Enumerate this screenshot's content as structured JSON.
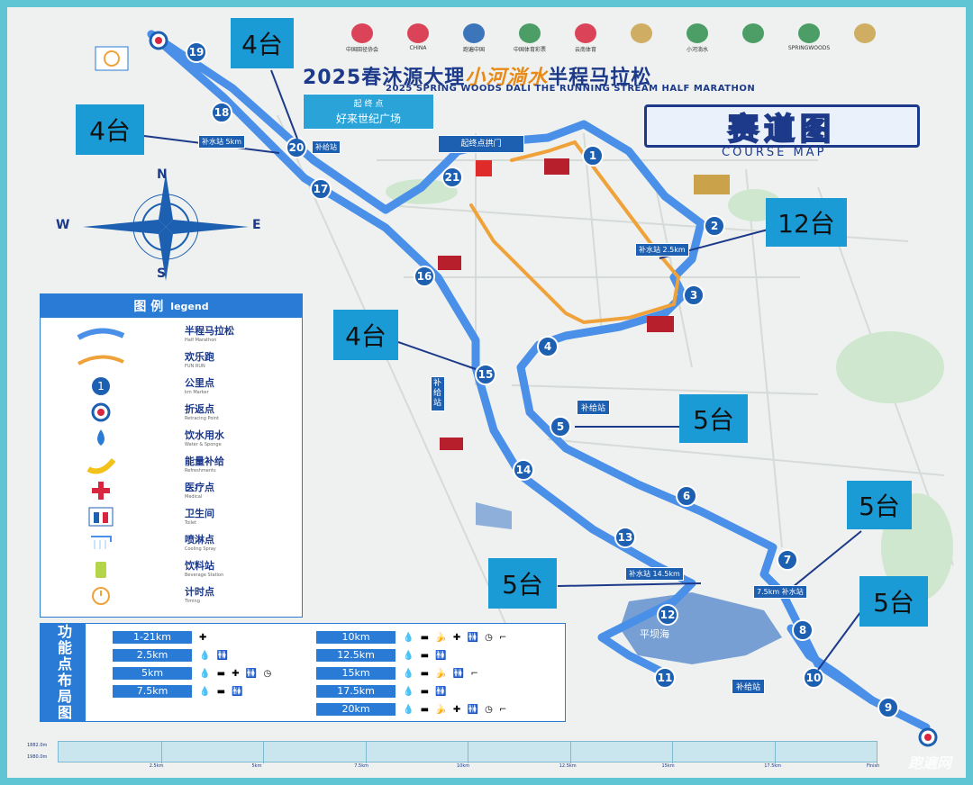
{
  "title": {
    "cn_prefix": "2025春沐源大理",
    "cn_brand": "小河淌水",
    "cn_suffix": "半程马拉松",
    "en": "2025 SPRING WOODS DALI THE RUNNING STREAM HALF MARATHON"
  },
  "course_map": {
    "cn": "赛道图",
    "en": "COURSE MAP"
  },
  "sponsors": [
    {
      "name": "中国田径协会",
      "color": "r"
    },
    {
      "name": "CHINA",
      "color": "r"
    },
    {
      "name": "跑遍中国",
      "color": "b"
    },
    {
      "name": "中国体育彩票",
      "color": "g"
    },
    {
      "name": "云南体育",
      "color": "r"
    },
    {
      "name": "",
      "color": ""
    },
    {
      "name": "小河淌水",
      "color": "g"
    },
    {
      "name": "",
      "color": "g"
    },
    {
      "name": "SPRINGWOODS",
      "color": "g"
    },
    {
      "name": "",
      "color": ""
    }
  ],
  "start_finish": {
    "label_top": "起 终 点",
    "label_main": "好来世纪广场",
    "arch": "起终点拱门"
  },
  "km_markers": [
    "1",
    "2",
    "3",
    "4",
    "5",
    "6",
    "7",
    "8",
    "9",
    "10",
    "11",
    "12",
    "13",
    "14",
    "15",
    "16",
    "17",
    "18",
    "19",
    "20",
    "21"
  ],
  "aid_station_label": "补给站",
  "water_station_label": "补水站",
  "lake_label": "平坝海",
  "distance_labels": {
    "d25": "2.5km",
    "d75": "7.5km",
    "d145": "14.5km",
    "d5": "5km"
  },
  "counts": [
    {
      "id": "c1",
      "text": "4台"
    },
    {
      "id": "c2",
      "text": "4台"
    },
    {
      "id": "c3",
      "text": "12台"
    },
    {
      "id": "c4",
      "text": "4台"
    },
    {
      "id": "c5",
      "text": "5台"
    },
    {
      "id": "c6",
      "text": "5台"
    },
    {
      "id": "c7",
      "text": "5台"
    },
    {
      "id": "c8",
      "text": "5台"
    }
  ],
  "compass": {
    "n": "N",
    "s": "S",
    "e": "E",
    "w": "W"
  },
  "legend": {
    "title": "图  例",
    "title_en": "legend",
    "items": [
      {
        "cn": "半程马拉松",
        "en": "Half Marathon"
      },
      {
        "cn": "欢乐跑",
        "en": "FUN RUN"
      },
      {
        "cn": "公里点",
        "en": "km Marker"
      },
      {
        "cn": "折返点",
        "en": "Retracing Point"
      },
      {
        "cn": "饮水用水",
        "en": "Water & Sponge"
      },
      {
        "cn": "能量补给",
        "en": "Refreshments"
      },
      {
        "cn": "医疗点",
        "en": "Medical"
      },
      {
        "cn": "卫生间",
        "en": "Toilet"
      },
      {
        "cn": "喷淋点",
        "en": "Cooling Spray"
      },
      {
        "cn": "饮料站",
        "en": "Beverage Station"
      },
      {
        "cn": "计时点",
        "en": "Timing"
      }
    ]
  },
  "function_panel": {
    "side": "功能点布局图",
    "rows": [
      {
        "label": "1-21km",
        "icons": "✚"
      },
      {
        "label": "2.5km",
        "icons": "💧 🚻"
      },
      {
        "label": "5km",
        "icons": "💧 ▬ ✚ 🚻 ◷"
      },
      {
        "label": "7.5km",
        "icons": "💧 ▬ 🚻"
      },
      {
        "label": "10km",
        "icons": "💧 ▬ 🍌 ✚ 🚻 ◷ ⌐"
      },
      {
        "label": "12.5km",
        "icons": "💧 ▬ 🚻"
      },
      {
        "label": "15km",
        "icons": "💧 ▬ 🍌 🚻 ⌐"
      },
      {
        "label": "17.5km",
        "icons": "💧 ▬ 🚻"
      },
      {
        "label": "20km",
        "icons": "💧 ▬ 🍌 ✚ 🚻 ◷ ⌐"
      }
    ]
  },
  "elevation": {
    "y_labels": [
      "1882.0m",
      "1980.0m"
    ],
    "x_labels": [
      "2.5km",
      "5km",
      "7.5km",
      "10km",
      "12.5km",
      "15km",
      "17.5km",
      "Finish"
    ]
  },
  "watermark": "跑遍网",
  "colors": {
    "half_route": "#4a8fe8",
    "fun_route": "#f0a23a",
    "count_box": "#1a9bd6",
    "accent": "#1d3a8a"
  }
}
